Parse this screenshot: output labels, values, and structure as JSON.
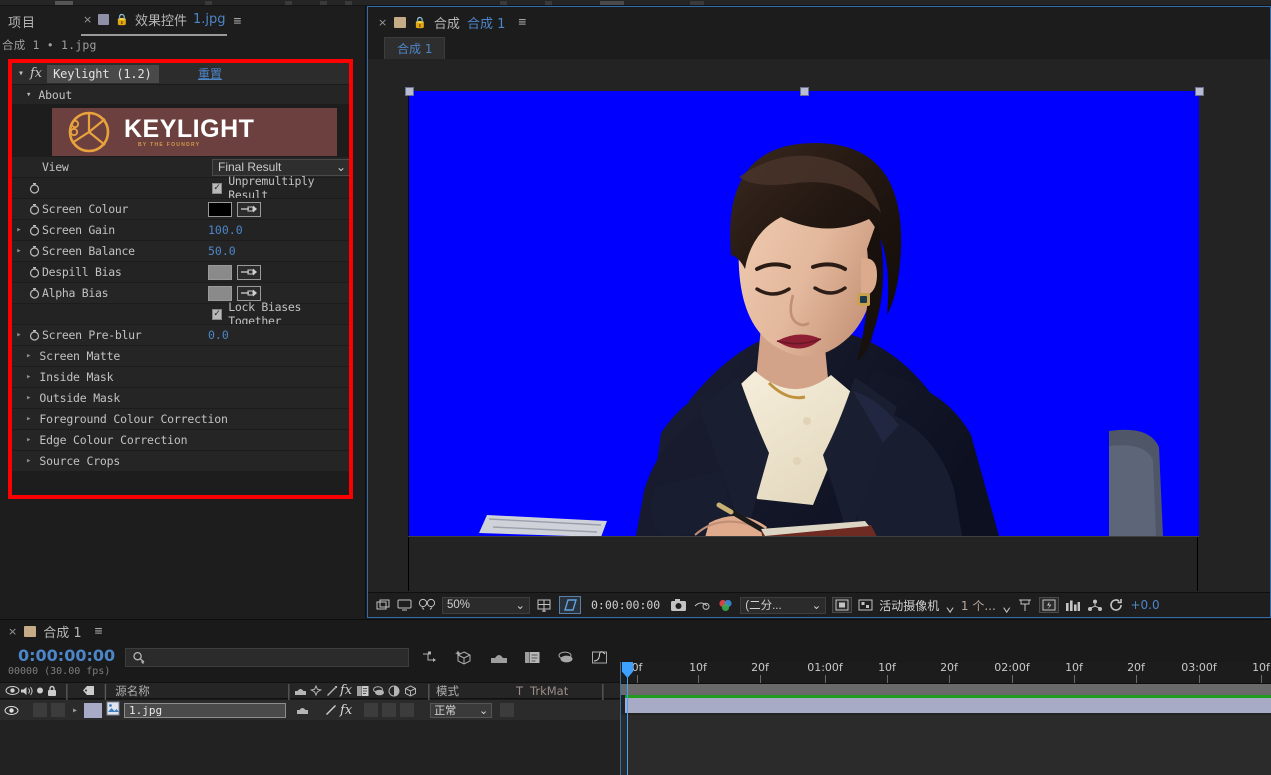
{
  "app": {
    "accent": "#4d86c8",
    "red_highlight": "#ff0000",
    "screen_blue": "#0000ff"
  },
  "project_panel": {
    "tab_project": "项目",
    "close_x": "×",
    "lock_icon": "lock-icon",
    "tab_effect_controls": "效果控件",
    "tab_file": "1.jpg",
    "menu_icon": "≡",
    "breadcrumb": "合成 1 • 1.jpg"
  },
  "effect": {
    "fx_glyph": "fx",
    "name": "Keylight (1.2)",
    "reset_label": "重置",
    "about_label": "About",
    "banner": {
      "title": "KEYLIGHT",
      "subtitle": "BY THE FOUNDRY"
    },
    "params": [
      {
        "label": "View",
        "type": "dropdown",
        "value": "Final Result",
        "expand": false,
        "stopwatch": false
      },
      {
        "label": "",
        "type": "checkbox",
        "value": "Unpremultiply Result",
        "checked": true,
        "expand": false,
        "stopwatch": true
      },
      {
        "label": "Screen Colour",
        "type": "colour",
        "swatch": "#000000",
        "expand": false,
        "stopwatch": true
      },
      {
        "label": "Screen Gain",
        "type": "number",
        "value": "100.0",
        "expand": true,
        "stopwatch": true
      },
      {
        "label": "Screen Balance",
        "type": "number",
        "value": "50.0",
        "expand": true,
        "stopwatch": true
      },
      {
        "label": "Despill Bias",
        "type": "colour",
        "swatch": "#8a8a8a",
        "expand": false,
        "stopwatch": true
      },
      {
        "label": "Alpha Bias",
        "type": "colour",
        "swatch": "#8a8a8a",
        "expand": false,
        "stopwatch": true
      },
      {
        "label": "",
        "type": "checkbox",
        "value": "Lock Biases Together",
        "checked": true,
        "expand": false,
        "stopwatch": false
      },
      {
        "label": "Screen Pre-blur",
        "type": "number",
        "value": "0.0",
        "expand": true,
        "stopwatch": true
      }
    ],
    "groups": [
      "Screen Matte",
      "Inside Mask",
      "Outside Mask",
      "Foreground Colour Correction",
      "Edge Colour Correction",
      "Source Crops"
    ]
  },
  "comp_panel": {
    "close_x": "×",
    "lock_icon": "lock-icon",
    "label_comp": "合成",
    "tab_name": "合成 1",
    "menu_icon": "≡",
    "chip": "合成 1",
    "toolbar": {
      "zoom": "50%",
      "timecode": "0:00:00:00",
      "resolution": "(二分...",
      "camera": "活动摄像机",
      "views": "1 个...",
      "exposure": "+0.0",
      "icons": [
        "main-view-icon",
        "monitor-icon",
        "3d-glasses-icon",
        "grid-icon",
        "region-of-interest-icon",
        "snapshot-icon",
        "show-snapshot-icon",
        "channel-icon",
        "transparency-grid-icon",
        "toggle-mask-icon",
        "timeline-graph-icon",
        "renderer-icon",
        "reset-exposure-icon"
      ]
    }
  },
  "timeline": {
    "close_x": "×",
    "tab_name": "合成 1",
    "menu_icon": "≡",
    "current_time": "0:00:00:00",
    "frame_info": "00000 (30.00 fps)",
    "search_placeholder": "",
    "search_icon": "magnifier-icon",
    "toolbar_icons": [
      "composition-mini-flowchart-icon",
      "draft-3d-icon",
      "hide-shy-layers-icon",
      "frame-blending-icon",
      "motion-blur-icon",
      "graph-editor-icon"
    ],
    "columns": {
      "eye": "eye-icon",
      "audio": "speaker-icon",
      "solo": "solo-icon",
      "lock": "lock-icon",
      "label": "label-tag-icon",
      "source_name": "源名称",
      "switch_icons": [
        "shy-icon",
        "collapse-icon",
        "quality-icon",
        "effects-icon",
        "frame-blend-icon",
        "motion-blur-icon",
        "adjustment-icon",
        "3d-layer-icon"
      ],
      "mode": "模式",
      "t": "T",
      "trkmat": "TrkMat"
    },
    "layers": [
      {
        "index": "",
        "name": "1.jpg",
        "mode": "正常",
        "visible": true
      }
    ],
    "ruler_labels": [
      "0f",
      "10f",
      "20f",
      "01:00f",
      "10f",
      "20f",
      "02:00f",
      "10f",
      "20f",
      "03:00f",
      "10f"
    ],
    "ruler_positions": [
      2,
      63,
      125,
      190,
      252,
      314,
      377,
      439,
      501,
      564,
      626
    ]
  }
}
